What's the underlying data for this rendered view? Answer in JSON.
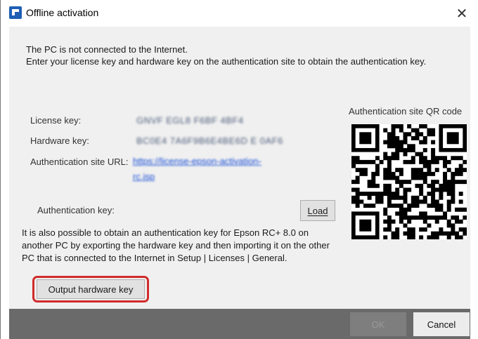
{
  "window": {
    "title": "Offline activation",
    "close_glyph": "✕"
  },
  "intro": {
    "line1": "The PC is not connected to the Internet.",
    "line2": "Enter your license key and hardware key on the authentication site to obtain the authentication key."
  },
  "fields": {
    "license_label": "License key:",
    "license_value": "GNVF EGL8 F6BF 4BF4",
    "hardware_label": "Hardware key:",
    "hardware_value": "BC0E4 7A6F9B6E4BE6D E 0AF6",
    "url_label": "Authentication site URL:",
    "url_line1": "https://license-epson-activation-",
    "url_line2": "rc.jsp",
    "auth_key_label": "Authentication key:"
  },
  "qr": {
    "title": "Authentication site QR code"
  },
  "buttons": {
    "load_label": "Load",
    "output_label": "Output hardware key",
    "ok_label": "OK",
    "cancel_label": "Cancel"
  },
  "note": {
    "text": "It is also possible to obtain an authentication key for Epson RC+ 8.0 on another PC by exporting the hardware key and then importing it on the other PC that is connected to the Internet in Setup | Licenses | General."
  },
  "colors": {
    "highlight": "#d12b2b",
    "link": "#1a4fd6",
    "footer": "#6a6a6a"
  },
  "icons": {
    "app": "epson-rc-app-icon",
    "close": "close-icon",
    "qr": "qr-code"
  }
}
